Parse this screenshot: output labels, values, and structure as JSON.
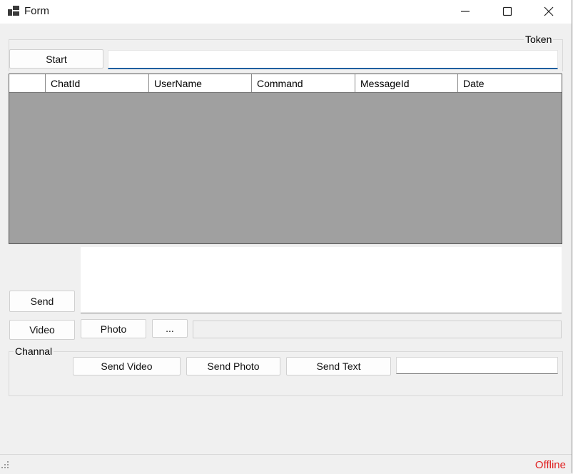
{
  "window": {
    "title": "Form",
    "minimize_icon": "minimize-icon",
    "maximize_icon": "maximize-icon",
    "close_icon": "close-icon",
    "app_icon": "form-app-icon"
  },
  "token": {
    "label": "Token",
    "start_label": "Start",
    "value": ""
  },
  "grid": {
    "columns": [
      "",
      "ChatId",
      "UserName",
      "Command",
      "MessageId",
      "Date"
    ]
  },
  "message": {
    "text": "",
    "send_label": "Send",
    "video_label": "Video",
    "photo_label": "Photo",
    "browse_label": "...",
    "path_value": ""
  },
  "channel": {
    "label": "Channal",
    "send_video_label": "Send Video",
    "send_photo_label": "Send Photo",
    "send_text_label": "Send Text",
    "channel_value": ""
  },
  "status": {
    "text": "Offline",
    "color": "#e02020"
  }
}
